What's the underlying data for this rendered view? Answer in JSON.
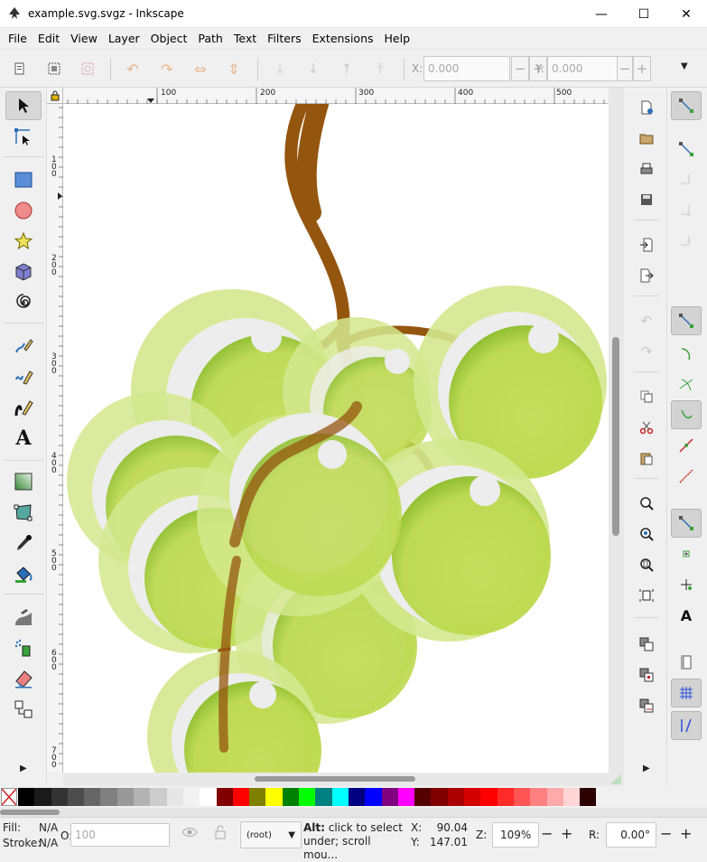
{
  "window": {
    "title": "example.svg.svgz - Inkscape",
    "minimize": "—",
    "maximize": "☐",
    "close": "✕"
  },
  "menu": [
    "File",
    "Edit",
    "View",
    "Layer",
    "Object",
    "Path",
    "Text",
    "Filters",
    "Extensions",
    "Help"
  ],
  "coords": {
    "x_label": "X:",
    "x_value": "0.000",
    "y_label": "Y:",
    "y_value": "0.000",
    "minus": "−",
    "plus": "+"
  },
  "ruler": {
    "h_labels": [
      "100",
      "200",
      "300",
      "400",
      "500"
    ],
    "v_labels": [
      "1\n0\n0",
      "2\n0\n0",
      "3\n0\n0",
      "4\n0\n0",
      "5\n0\n0",
      "6\n0\n0",
      "7\n0\n0"
    ]
  },
  "tools": [
    "selector-tool",
    "node-tool",
    "rect-tool",
    "ellipse-tool",
    "star-tool",
    "3dbox-tool",
    "spiral-tool",
    "pencil-tool",
    "pen-tool",
    "calligraphy-tool",
    "text-tool",
    "gradient-tool",
    "mesh-tool",
    "dropper-tool",
    "paint-bucket-tool",
    "tweak-tool",
    "spray-tool",
    "eraser-tool",
    "connector-tool"
  ],
  "text_tool_glyph": "A",
  "palette": {
    "colors": [
      "#000000",
      "#1a1a1a",
      "#333333",
      "#4d4d4d",
      "#666666",
      "#808080",
      "#999999",
      "#b3b3b3",
      "#cccccc",
      "#e6e6e6",
      "#f2f2f2",
      "#ffffff",
      "#800000",
      "#ff0000",
      "#808000",
      "#ffff00",
      "#008000",
      "#00ff00",
      "#008080",
      "#00ffff",
      "#000080",
      "#0000ff",
      "#800080",
      "#ff00ff",
      "#550000",
      "#800000",
      "#aa0000",
      "#d40000",
      "#ff0000",
      "#ff2a2a",
      "#ff5555",
      "#ff8080",
      "#ffaaaa",
      "#ffd5d5",
      "#2b0000"
    ]
  },
  "status": {
    "fill_label": "Fill:",
    "fill_value": "N/A",
    "stroke_label": "Stroke:",
    "stroke_value": "N/A",
    "opacity_label": "O:",
    "opacity_value": "100",
    "layer": "(root)",
    "message_bold": "Alt:",
    "message_line1": " click to select",
    "message_line2": "under; scroll mou...",
    "cursor_x_label": "X:",
    "cursor_x": "90.04",
    "cursor_y_label": "Y:",
    "cursor_y": "147.01",
    "zoom_label": "Z:",
    "zoom": "109%",
    "rotate_label": "R:",
    "rotate": "0.00°",
    "minus": "−",
    "plus": "+"
  },
  "colors": {
    "grape_light": "#c8e05a",
    "grape_rim": "#d6ea8a",
    "stem": "#94560f",
    "highlight": "#eeeeee"
  }
}
